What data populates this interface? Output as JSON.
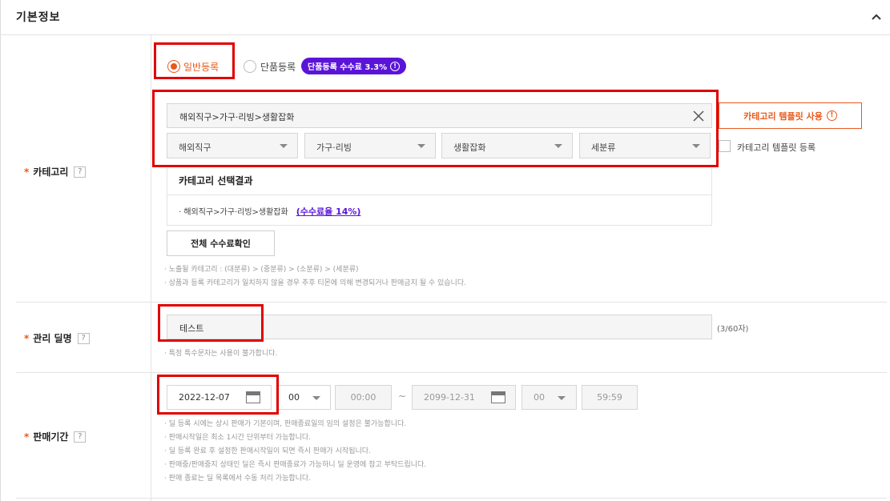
{
  "section": {
    "title": "기본정보",
    "collapse_icon": "chevron-up-icon"
  },
  "category": {
    "label": "카테고리",
    "required_mark": "*",
    "help_mark": "?",
    "radio_general": "일반등록",
    "radio_single": "단품등록",
    "single_badge": "단품등록 수수료 3.3%",
    "path_value": "해외직구>가구·리빙>생활잡화",
    "selects": [
      "해외직구",
      "가구·리빙",
      "생활잡화",
      "세분류"
    ],
    "template_button": "카테고리 템플릿 사용",
    "template_register": "카테고리 템플릿 등록",
    "result_title": "카테고리 선택결과",
    "result_path": "해외직구>가구·리빙>생활잡화",
    "result_fee": "(수수료율 14%)",
    "fee_check_button": "전체 수수료확인",
    "notes": [
      "· 노출될 카테고리 : (대분류) > (중분류) > (소분류) > (세분류)",
      "· 상품과 등록 카테고리가 일치하지 않을 경우 추후 티몬에 의해 변경되거나 판매금지 될 수 있습니다."
    ]
  },
  "deal_name": {
    "label": "관리 딜명",
    "required_mark": "*",
    "help_mark": "?",
    "value": "테스트",
    "counter": "(3/60자)",
    "note": "· 특정 특수문자는 사용이 불가합니다."
  },
  "sale_period": {
    "label": "판매기간",
    "required_mark": "*",
    "help_mark": "?",
    "start_date": "2022-12-07",
    "start_hour": "00",
    "start_time": "00:00",
    "tilde": "~",
    "end_date": "2099-12-31",
    "end_hour": "00",
    "end_time": "59:59",
    "notes": [
      "· 딜 등록 시에는 상시 판매가 기본이며, 판매종료일의 임의 설정은 불가능합니다.",
      "· 판매시작일은 최소 1시간 단위부터 가능합니다.",
      "· 딜 등록 완료 후 설정한 판매시작일이 되면 즉시 판매가 시작됩니다.",
      "· 판매중/판매중지 상태인 딜은 즉시 판매종료가 가능하니 딜 운영에 참고 부탁드립니다.",
      "· 판매 종료는 딜 목록에서 수동 처리 가능합니다."
    ]
  },
  "colors": {
    "accent": "#e85a1c",
    "badge": "#5a14d8",
    "highlight": "#e00000"
  }
}
